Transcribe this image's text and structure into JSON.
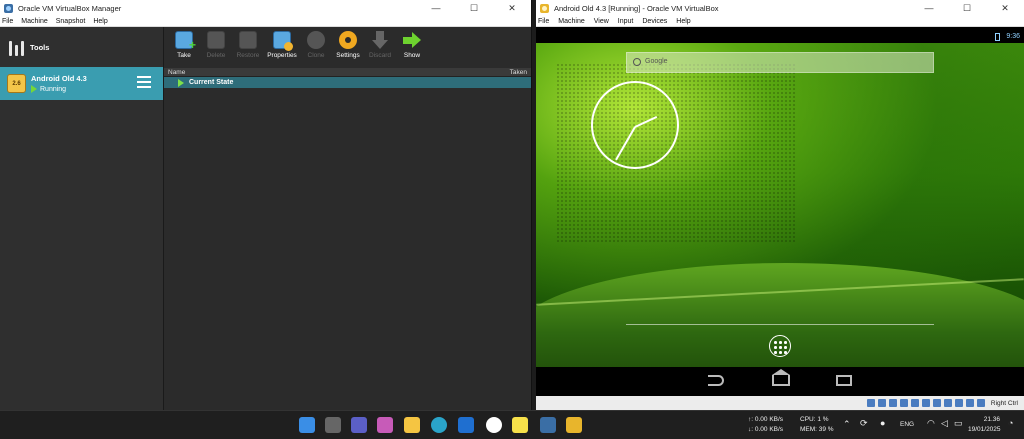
{
  "manager": {
    "title": "Oracle VM VirtualBox Manager",
    "window_controls": {
      "minimize": "—",
      "maximize": "☐",
      "close": "✕"
    },
    "menu": [
      "File",
      "Machine",
      "Snapshot",
      "Help"
    ],
    "sidebar": {
      "tools_label": "Tools",
      "vm": {
        "name": "Android Old 4.3",
        "badge": "2.6",
        "state": "Running"
      }
    },
    "toolbar": [
      {
        "label": "Take",
        "icon": "take-snapshot-icon",
        "enabled": true
      },
      {
        "label": "Delete",
        "icon": "delete-snapshot-icon",
        "enabled": false
      },
      {
        "label": "Restore",
        "icon": "restore-snapshot-icon",
        "enabled": false
      },
      {
        "label": "Properties",
        "icon": "properties-icon",
        "enabled": true
      },
      {
        "label": "Clone",
        "icon": "clone-icon",
        "enabled": false
      },
      {
        "label": "Settings",
        "icon": "settings-gear-icon",
        "enabled": true
      },
      {
        "label": "Discard",
        "icon": "discard-arrow-icon",
        "enabled": false
      },
      {
        "label": "Show",
        "icon": "show-arrow-icon",
        "enabled": true
      }
    ],
    "snapshots": {
      "columns": {
        "name": "Name",
        "taken": "Taken"
      },
      "rows": [
        {
          "name": "Current State"
        }
      ]
    }
  },
  "vm_window": {
    "title": "Android Old 4.3 [Running] - Oracle VM VirtualBox",
    "window_controls": {
      "minimize": "—",
      "maximize": "☐",
      "close": "✕"
    },
    "menu": [
      "File",
      "Machine",
      "View",
      "Input",
      "Devices",
      "Help"
    ],
    "android": {
      "status_time": "9:36",
      "search_placeholder": "Google"
    },
    "host_key": "Right Ctrl"
  },
  "taskbar": {
    "network": {
      "up": "↑: 0.00 KB/s",
      "down": "↓: 0.00 KB/s"
    },
    "cpu": "CPU: 1 %",
    "mem": "MEM: 39 %",
    "lang": "ENG",
    "time": "21.36",
    "date": "19/01/2025"
  },
  "colors": {
    "selection": "#3a9db0",
    "snapshot_selected": "#2e6d7a",
    "android_green": "#3d8a0c"
  }
}
